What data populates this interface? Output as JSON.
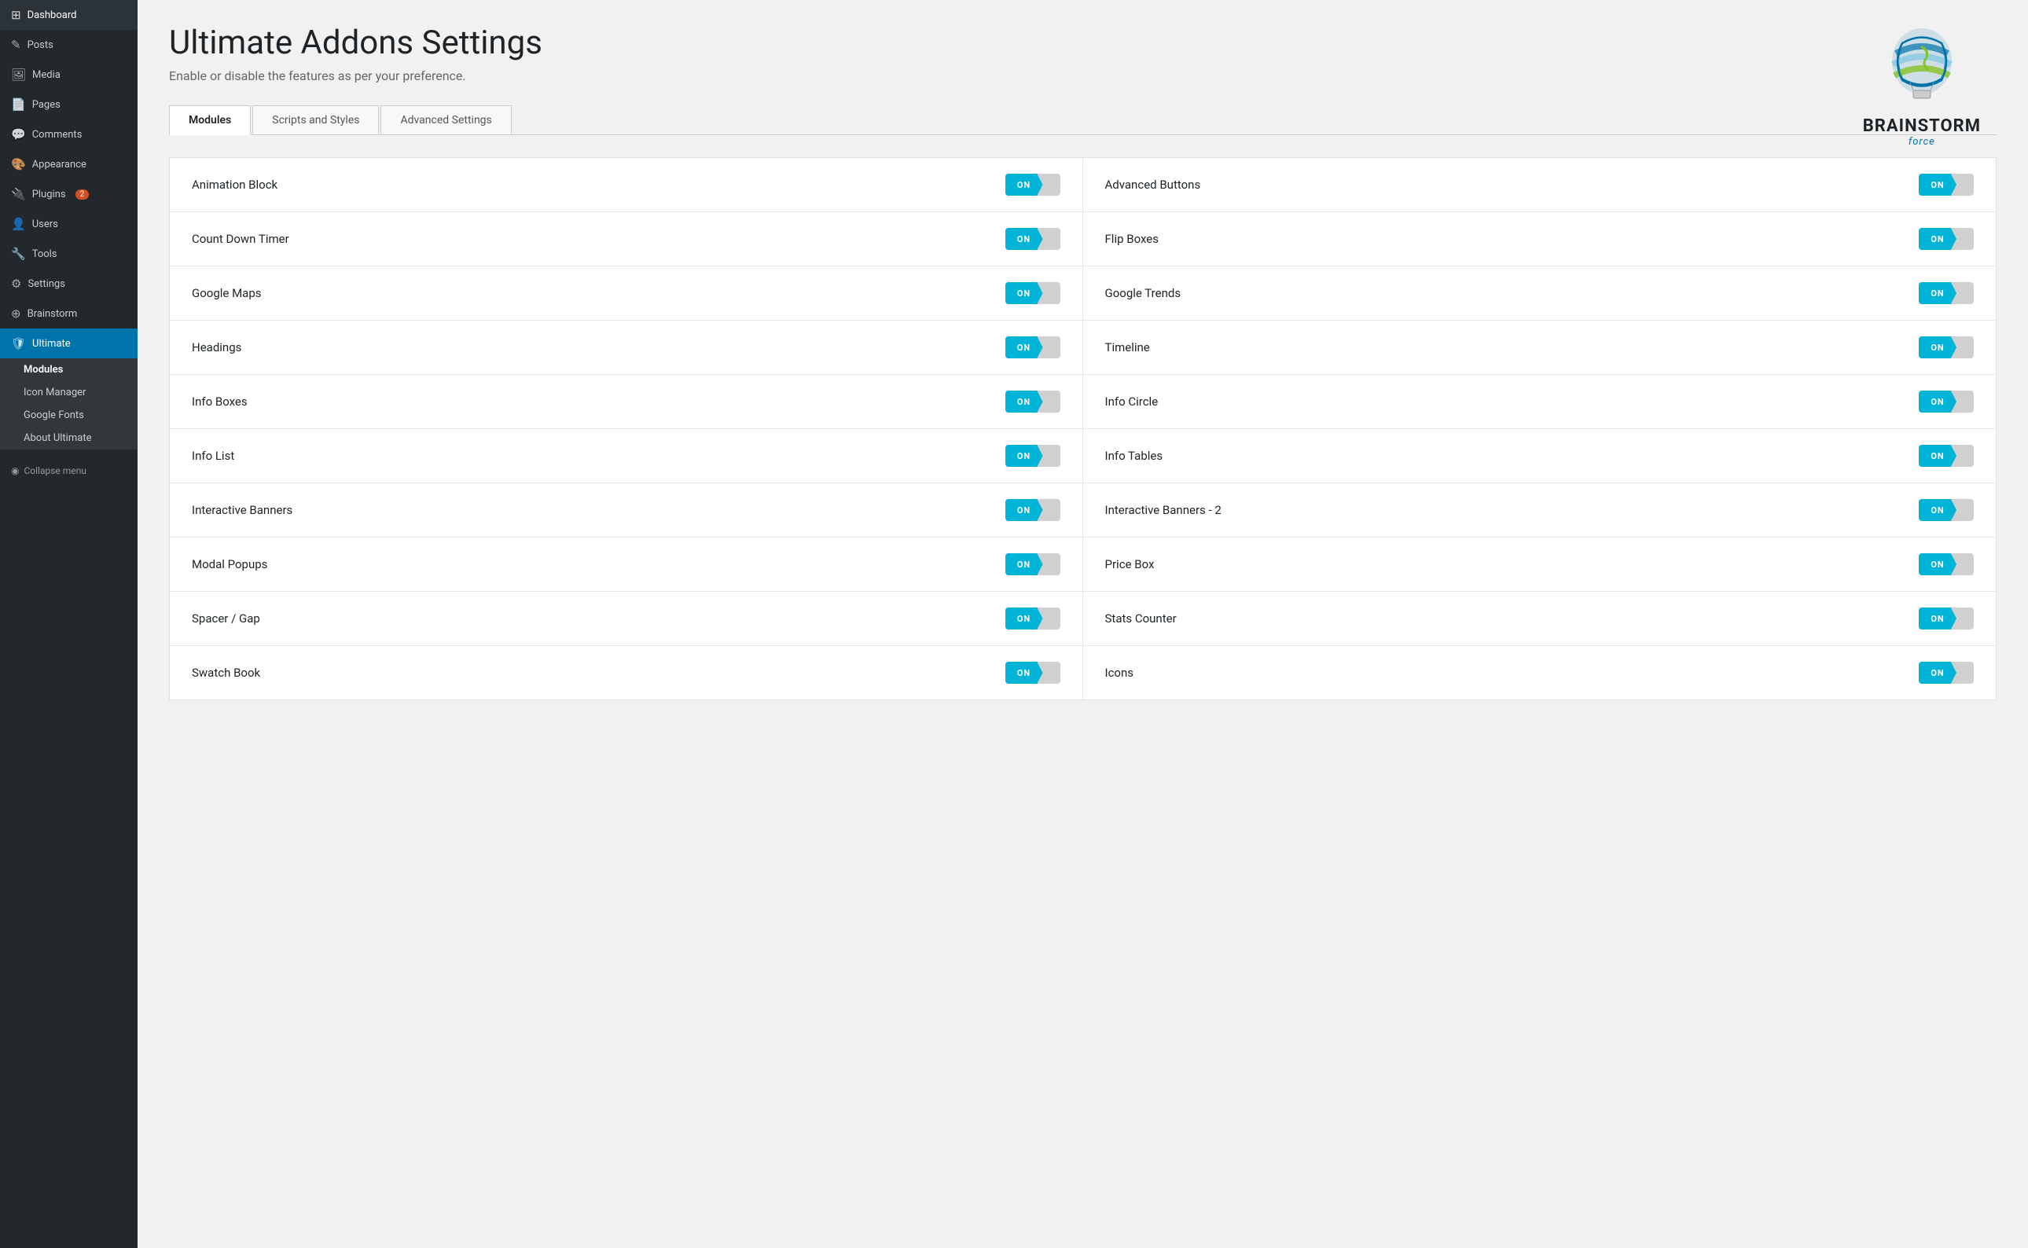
{
  "sidebar": {
    "items": [
      {
        "label": "Dashboard",
        "icon": "⊞",
        "name": "dashboard"
      },
      {
        "label": "Posts",
        "icon": "✎",
        "name": "posts"
      },
      {
        "label": "Media",
        "icon": "🖼",
        "name": "media"
      },
      {
        "label": "Pages",
        "icon": "📄",
        "name": "pages"
      },
      {
        "label": "Comments",
        "icon": "💬",
        "name": "comments"
      },
      {
        "label": "Appearance",
        "icon": "🎨",
        "name": "appearance"
      },
      {
        "label": "Plugins",
        "icon": "🔌",
        "name": "plugins",
        "badge": "2"
      },
      {
        "label": "Users",
        "icon": "👤",
        "name": "users"
      },
      {
        "label": "Tools",
        "icon": "🔧",
        "name": "tools"
      },
      {
        "label": "Settings",
        "icon": "⚙",
        "name": "settings"
      },
      {
        "label": "Brainstorm",
        "icon": "⊕",
        "name": "brainstorm"
      },
      {
        "label": "Ultimate",
        "icon": "🛡",
        "name": "ultimate",
        "active": true
      }
    ],
    "submenu": [
      {
        "label": "Modules",
        "name": "modules",
        "active": true
      },
      {
        "label": "Icon Manager",
        "name": "icon-manager"
      },
      {
        "label": "Google Fonts",
        "name": "google-fonts"
      },
      {
        "label": "About Ultimate",
        "name": "about-ultimate"
      }
    ],
    "collapse_label": "Collapse menu"
  },
  "page": {
    "title": "Ultimate Addons Settings",
    "subtitle": "Enable or disable the features as per your preference."
  },
  "logo": {
    "text": "BRAINSTORM",
    "sub": "force"
  },
  "tabs": [
    {
      "label": "Modules",
      "active": true
    },
    {
      "label": "Scripts and Styles",
      "active": false
    },
    {
      "label": "Advanced Settings",
      "active": false
    }
  ],
  "modules": [
    {
      "left": {
        "name": "Animation Block",
        "on": true
      },
      "right": {
        "name": "Advanced Buttons",
        "on": true
      }
    },
    {
      "left": {
        "name": "Count Down Timer",
        "on": true
      },
      "right": {
        "name": "Flip Boxes",
        "on": true
      }
    },
    {
      "left": {
        "name": "Google Maps",
        "on": true
      },
      "right": {
        "name": "Google Trends",
        "on": true
      }
    },
    {
      "left": {
        "name": "Headings",
        "on": true
      },
      "right": {
        "name": "Timeline",
        "on": true
      }
    },
    {
      "left": {
        "name": "Info Boxes",
        "on": true
      },
      "right": {
        "name": "Info Circle",
        "on": true
      }
    },
    {
      "left": {
        "name": "Info List",
        "on": true
      },
      "right": {
        "name": "Info Tables",
        "on": true
      }
    },
    {
      "left": {
        "name": "Interactive Banners",
        "on": true
      },
      "right": {
        "name": "Interactive Banners - 2",
        "on": true
      }
    },
    {
      "left": {
        "name": "Modal Popups",
        "on": true
      },
      "right": {
        "name": "Price Box",
        "on": true
      }
    },
    {
      "left": {
        "name": "Spacer / Gap",
        "on": true
      },
      "right": {
        "name": "Stats Counter",
        "on": true
      }
    },
    {
      "left": {
        "name": "Swatch Book",
        "on": true
      },
      "right": {
        "name": "Icons",
        "on": true
      }
    }
  ],
  "toggle_on_label": "ON"
}
